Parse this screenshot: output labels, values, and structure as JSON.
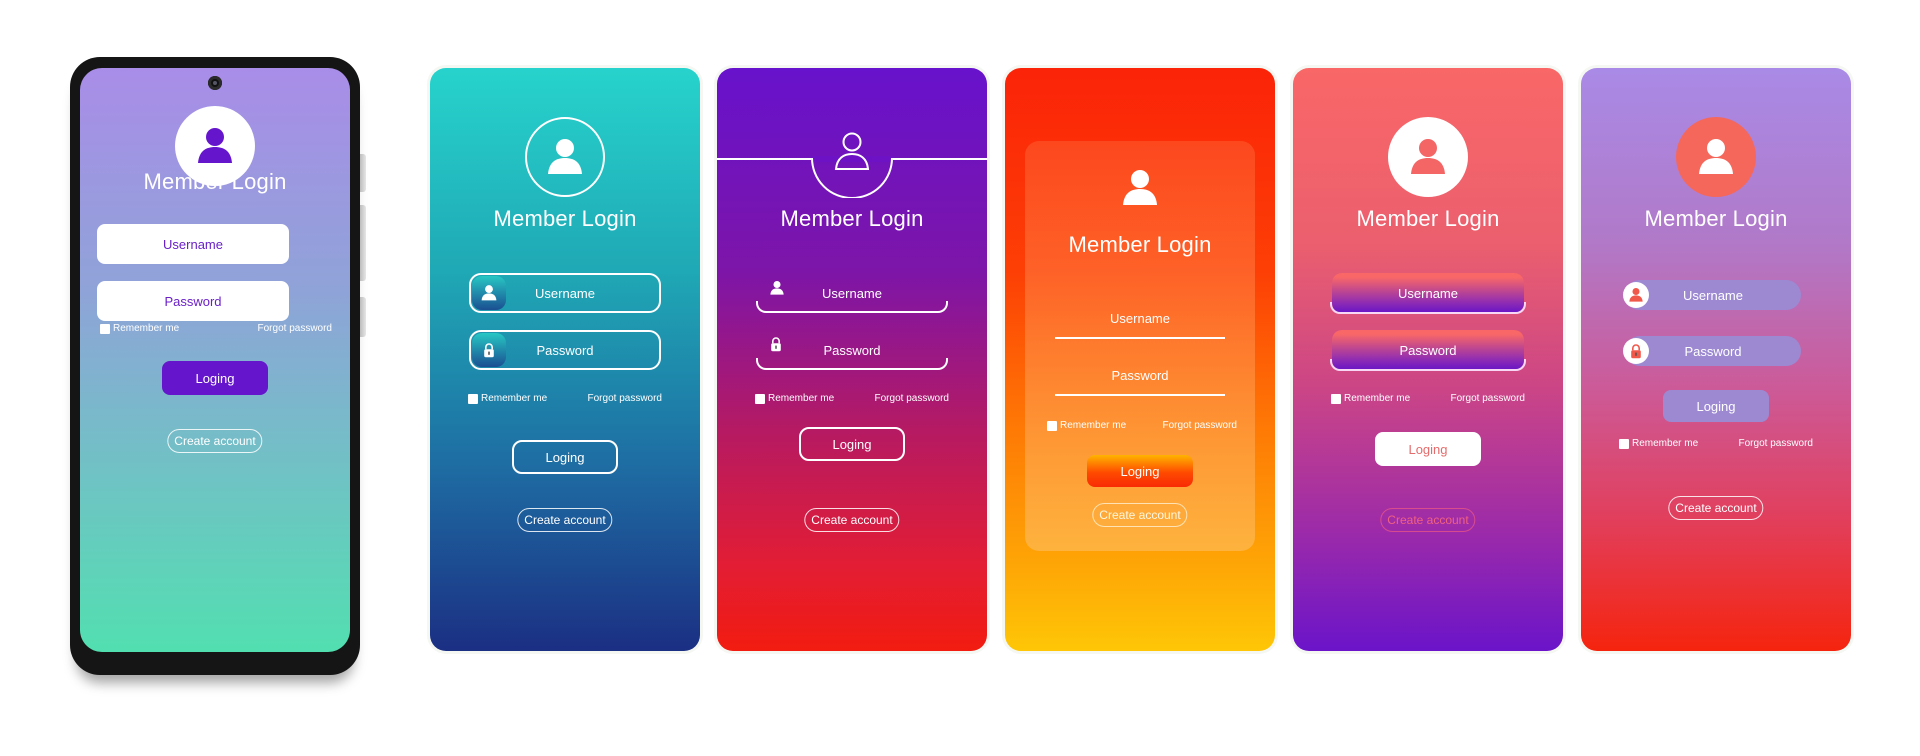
{
  "phone": {
    "title": "Member Login",
    "username_placeholder": "Username",
    "password_placeholder": "Password",
    "remember_label": "Remember me",
    "forgot_label": "Forgot password",
    "login_label": "Loging",
    "create_label": "Create account",
    "colors": {
      "accent": "#6515cc",
      "gradient_top": "#a98de8",
      "gradient_bottom": "#52dfb0"
    }
  },
  "cards": [
    {
      "theme": "teal-navy",
      "title": "Member Login",
      "username_placeholder": "Username",
      "password_placeholder": "Password",
      "remember_label": "Remember me",
      "forgot_label": "Forgot password",
      "login_label": "Loging",
      "create_label": "Create account",
      "colors": {
        "top": "#27d3cc",
        "bottom": "#1b2f83"
      }
    },
    {
      "theme": "purple-red",
      "title": "Member Login",
      "username_placeholder": "Username",
      "password_placeholder": "Password",
      "remember_label": "Remember me",
      "forgot_label": "Forgot password",
      "login_label": "Loging",
      "create_label": "Create account",
      "colors": {
        "top": "#6712cc",
        "bottom": "#f21c10"
      }
    },
    {
      "theme": "red-yellow",
      "title": "Member Login",
      "username_placeholder": "Username",
      "password_placeholder": "Password",
      "remember_label": "Remember me",
      "forgot_label": "Forgot password",
      "login_label": "Loging",
      "create_label": "Create account",
      "colors": {
        "top": "#fb2308",
        "bottom": "#fec606"
      }
    },
    {
      "theme": "coral-purple",
      "title": "Member Login",
      "username_placeholder": "Username",
      "password_placeholder": "Password",
      "remember_label": "Remember me",
      "forgot_label": "Forgot password",
      "login_label": "Loging",
      "create_label": "Create account",
      "colors": {
        "top": "#f96767",
        "bottom": "#6b14c9"
      }
    },
    {
      "theme": "lavender-red",
      "title": "Member Login",
      "username_placeholder": "Username",
      "password_placeholder": "Password",
      "login_label": "Loging",
      "remember_label": "Remember me",
      "forgot_label": "Forgot password",
      "create_label": "Create account",
      "colors": {
        "top": "#a98ae6",
        "bottom": "#f5240e",
        "accent": "#f5675b"
      }
    }
  ],
  "icons": {
    "avatar": "user-icon",
    "username": "user-icon",
    "password": "lock-icon"
  }
}
